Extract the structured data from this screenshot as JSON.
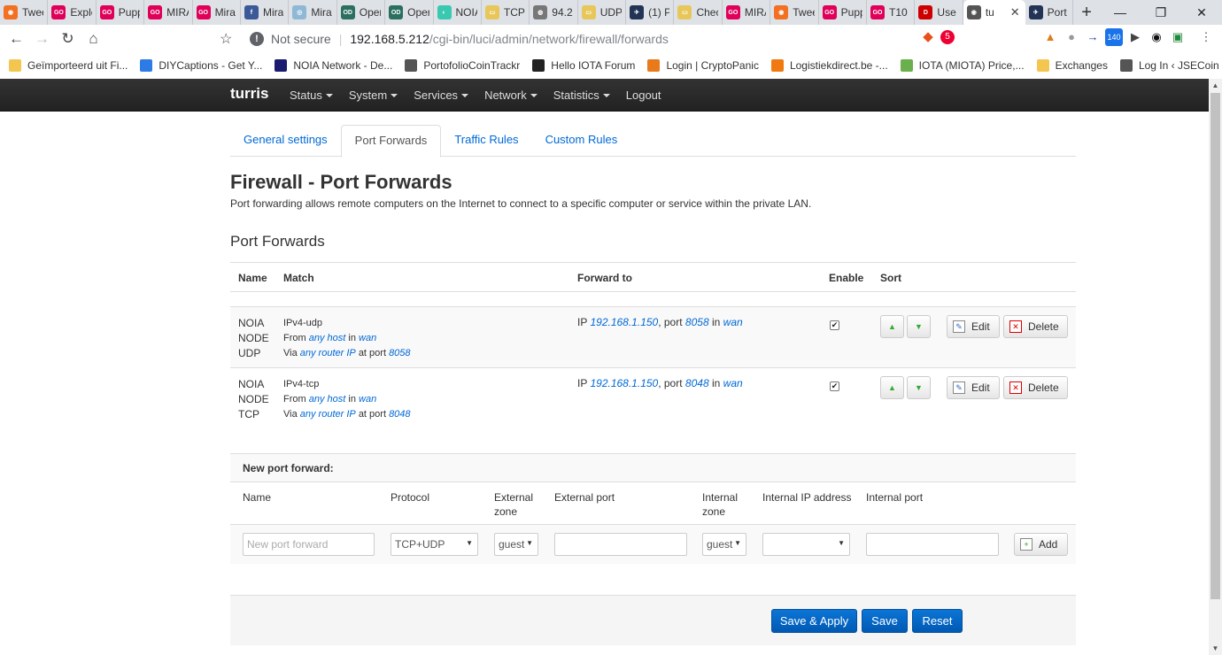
{
  "browser": {
    "tabs": [
      {
        "title": "Twee",
        "icon_color": "#f36f21",
        "icon_text": "◉"
      },
      {
        "title": "Explo",
        "icon_color": "#e0005a",
        "icon_text": "GO"
      },
      {
        "title": "Pupp",
        "icon_color": "#e0005a",
        "icon_text": "GO"
      },
      {
        "title": "MIRA",
        "icon_color": "#e0005a",
        "icon_text": "GO"
      },
      {
        "title": "Mira",
        "icon_color": "#e0005a",
        "icon_text": "GO"
      },
      {
        "title": "Mira",
        "icon_color": "#3b5998",
        "icon_text": "f"
      },
      {
        "title": "Mira",
        "icon_color": "#8fb8d6",
        "icon_text": "◎"
      },
      {
        "title": "Oper",
        "icon_color": "#2a6f5f",
        "icon_text": "OD"
      },
      {
        "title": "Oper",
        "icon_color": "#2a6f5f",
        "icon_text": "OD"
      },
      {
        "title": "NOIA",
        "icon_color": "#39c9b0",
        "icon_text": "◐"
      },
      {
        "title": "TCP",
        "icon_color": "#e8c75a",
        "icon_text": "▭"
      },
      {
        "title": "94.2",
        "icon_color": "#777777",
        "icon_text": "◍"
      },
      {
        "title": "UDP",
        "icon_color": "#e8c75a",
        "icon_text": "▭"
      },
      {
        "title": "(1) P",
        "icon_color": "#223355",
        "icon_text": "✈"
      },
      {
        "title": "Chec",
        "icon_color": "#e8c75a",
        "icon_text": "▭"
      },
      {
        "title": "MIRA",
        "icon_color": "#e0005a",
        "icon_text": "GO"
      },
      {
        "title": "Twee",
        "icon_color": "#f36f21",
        "icon_text": "◉"
      },
      {
        "title": "Pupp",
        "icon_color": "#e0005a",
        "icon_text": "GO"
      },
      {
        "title": "T10",
        "icon_color": "#e0005a",
        "icon_text": "GO"
      },
      {
        "title": "Use",
        "icon_color": "#cc0000",
        "icon_text": "D"
      },
      {
        "title": "tu",
        "icon_color": "#555555",
        "icon_text": "◉",
        "active": true
      },
      {
        "title": "Port",
        "icon_color": "#223355",
        "icon_text": "✈"
      }
    ],
    "new_tab": "+",
    "win_min": "—",
    "win_max": "❐",
    "win_close": "✕",
    "secure_label": "Not secure",
    "url_host": "192.168.5.212",
    "url_path": "/cgi-bin/luci/admin/network/firewall/forwards",
    "brave_badge": "5",
    "ext_badge": "140",
    "bookmarks": [
      {
        "label": "Geïmporteerd uit Fi...",
        "color": "#f3c74f"
      },
      {
        "label": "DIYCaptions - Get Y...",
        "color": "#2d7be5"
      },
      {
        "label": "NOIA Network - De...",
        "color": "#1a1a6e"
      },
      {
        "label": "PortofolioCoinTrackr",
        "color": "#555555"
      },
      {
        "label": "Hello IOTA Forum",
        "color": "#222222"
      },
      {
        "label": "Login | CryptoPanic",
        "color": "#e87a1c"
      },
      {
        "label": "Logistiekdirect.be -...",
        "color": "#f07a10"
      },
      {
        "label": "IOTA (MIOTA) Price,...",
        "color": "#6ab04c"
      },
      {
        "label": "Exchanges",
        "color": "#f3c74f"
      },
      {
        "label": "Log In ‹ JSECoin —...",
        "color": "#555555"
      }
    ],
    "bookmarks_more": "»"
  },
  "luci": {
    "brand": "turris",
    "menu": [
      "Status",
      "System",
      "Services",
      "Network",
      "Statistics",
      "Logout"
    ],
    "subtabs": [
      "General settings",
      "Port Forwards",
      "Traffic Rules",
      "Custom Rules"
    ],
    "title": "Firewall - Port Forwards",
    "description": "Port forwarding allows remote computers on the Internet to connect to a specific computer or service within the private LAN.",
    "section_title": "Port Forwards",
    "headers": {
      "name": "Name",
      "match": "Match",
      "forward": "Forward to",
      "enable": "Enable",
      "sort": "Sort"
    },
    "rows": [
      {
        "name": [
          "NOIA",
          "NODE",
          "UDP"
        ],
        "proto": "IPv4-udp",
        "from_prefix": "From",
        "from_host": "any host",
        "in_word": "in",
        "from_zone": "wan",
        "via_prefix": "Via",
        "via_router": "any router IP",
        "at_port": "at port",
        "ext_port": "8058",
        "fwd_prefix": "IP",
        "fwd_ip": "192.168.1.150",
        "fwd_port_word": ", port",
        "fwd_port": "8058",
        "fwd_in": "in",
        "fwd_zone": "wan",
        "enabled": "✔",
        "edit": "Edit",
        "delete": "Delete"
      },
      {
        "name": [
          "NOIA",
          "NODE",
          "TCP"
        ],
        "proto": "IPv4-tcp",
        "from_prefix": "From",
        "from_host": "any host",
        "in_word": "in",
        "from_zone": "wan",
        "via_prefix": "Via",
        "via_router": "any router IP",
        "at_port": "at port",
        "ext_port": "8048",
        "fwd_prefix": "IP",
        "fwd_ip": "192.168.1.150",
        "fwd_port_word": ", port",
        "fwd_port": "8048",
        "fwd_in": "in",
        "fwd_zone": "wan",
        "enabled": "✔",
        "edit": "Edit",
        "delete": "Delete"
      }
    ],
    "new": {
      "heading": "New port forward:",
      "labels": {
        "name": "Name",
        "protocol": "Protocol",
        "ext_zone_1": "External",
        "ext_zone_2": "zone",
        "ext_port": "External port",
        "int_zone_1": "Internal",
        "int_zone_2": "zone",
        "int_ip": "Internal IP address",
        "int_port": "Internal port"
      },
      "name_placeholder": "New port forward",
      "protocol_value": "TCP+UDP",
      "ext_zone_value": "guest",
      "int_zone_value": "guest",
      "add": "Add"
    },
    "actions": {
      "save_apply": "Save & Apply",
      "save": "Save",
      "reset": "Reset"
    }
  }
}
